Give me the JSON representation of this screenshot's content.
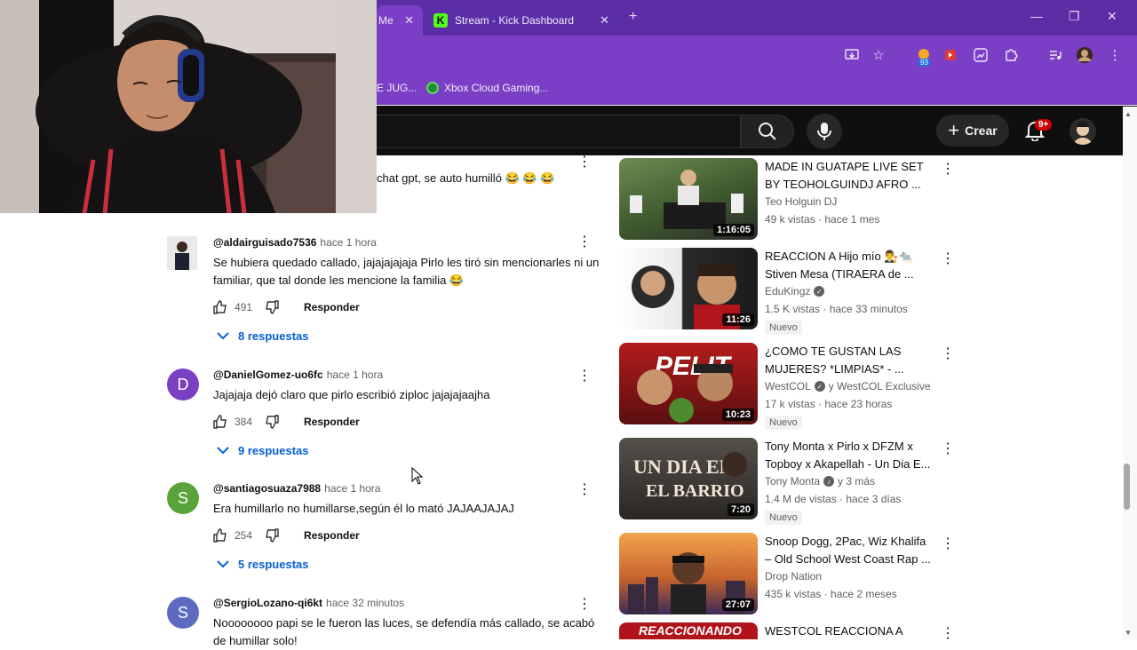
{
  "browser": {
    "tabs": [
      {
        "label": "Me",
        "close": "✕"
      },
      {
        "label": "Stream - Kick Dashboard",
        "close": "✕"
      }
    ],
    "new_tab": "+",
    "window_controls": {
      "minimize": "—",
      "restore": "❐",
      "close": "✕"
    },
    "extension_badge": "93",
    "bookmarks": [
      {
        "label": "E JUG..."
      },
      {
        "label": "Xbox Cloud Gaming..."
      }
    ]
  },
  "youtube_header": {
    "create_label": "Crear",
    "notifications_badge": "9+"
  },
  "partial_comment": {
    "text": "chat gpt, se auto humilló 😂 😂 😂"
  },
  "comments": [
    {
      "handle": "@aldairguisado7536",
      "time": "hace 1 hora",
      "text": "Se hubiera quedado callado, jajajajajaja Pirlo les tiró sin mencionarles ni un familiar, que tal donde les mencione la familia 😂",
      "likes": "491",
      "reply_label": "Responder",
      "replies": "8 respuestas",
      "avatar_letter": "",
      "avatar_color": "#3b3f4a"
    },
    {
      "handle": "@DanielGomez-uo6fc",
      "time": "hace 1 hora",
      "text": "Jajajaja dejó claro que pirlo escribió ziploc jajajajaajha",
      "likes": "384",
      "reply_label": "Responder",
      "replies": "9 respuestas",
      "avatar_letter": "D",
      "avatar_color": "#7b3fc4"
    },
    {
      "handle": "@santiagosuaza7988",
      "time": "hace 1 hora",
      "text": "Era humillarlo no humillarse,según él lo mató JAJAAJAJAJ",
      "likes": "254",
      "reply_label": "Responder",
      "replies": "5 respuestas",
      "avatar_letter": "S",
      "avatar_color": "#58a43a"
    },
    {
      "handle": "@SergioLozano-qi6kt",
      "time": "hace 32 minutos",
      "text": "Noooooooo papi se le fueron las luces, se defendía más callado, se acabó de humillar solo!",
      "avatar_letter": "S",
      "avatar_color": "#5c6bc0"
    }
  ],
  "videos": [
    {
      "title": "MADE IN GUATAPE  LIVE SET BY TEOHOLGUINDJ AFRO ...",
      "channel": "Teo Holguin DJ",
      "verified": false,
      "meta": "49 k vistas · hace 1 mes",
      "badge": "",
      "duration": "1:16:05",
      "thumb_color": "#3e5a2e"
    },
    {
      "title": "REACCION A Hijo mío 👨‍⚖️🐀 Stiven Mesa (TIRAERA de ...",
      "channel": "EduKingz",
      "verified": true,
      "meta": "1.5 K vistas · hace 33 minutos",
      "badge": "Nuevo",
      "duration": "11:26",
      "thumb_color": "#2a2a2a"
    },
    {
      "title": "¿COMO TE GUSTAN LAS MUJERES? *LIMPIAS* - ...",
      "channel": "WestCOL",
      "verified": true,
      "channel_extra": "y WestCOL Exclusive",
      "meta": "17 k vistas · hace 23 horas",
      "badge": "Nuevo",
      "duration": "10:23",
      "thumb_color": "#8a1e1e"
    },
    {
      "title": "Tony Monta x Pirlo x DFZM x Topboy x Akapellah - Un Dia E...",
      "channel": "Tony Monta",
      "verified": true,
      "channel_extra": "y 3 más",
      "meta": "1.4 M de vistas · hace 3 días",
      "badge": "Nuevo",
      "duration": "7:20",
      "thumb_color": "#3a3430"
    },
    {
      "title": "Snoop Dogg, 2Pac, Wiz Khalifa – Old School West Coast Rap ...",
      "channel": "Drop Nation",
      "verified": false,
      "meta": "435 k vistas · hace 2 meses",
      "badge": "",
      "duration": "27:07",
      "thumb_color": "#c86a2e"
    },
    {
      "title": "WESTCOL REACCIONA A",
      "channel": "",
      "verified": false,
      "meta": "",
      "badge": "",
      "duration": "",
      "thumb_color": "#b0131a",
      "thumb_text": "REACCIONANDO"
    }
  ]
}
